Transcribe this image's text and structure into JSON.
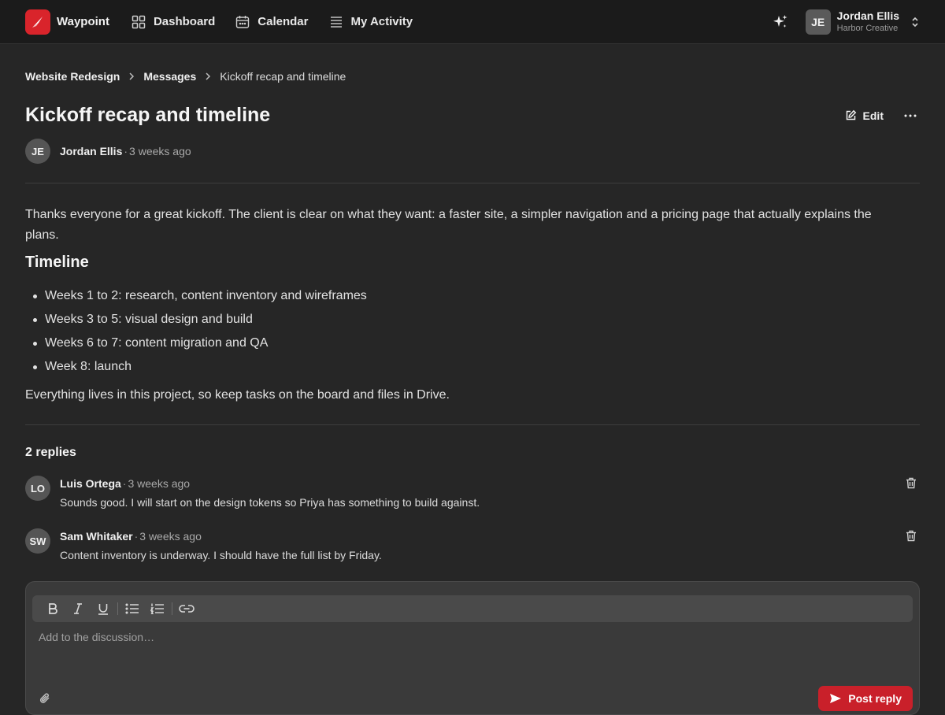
{
  "app": {
    "name": "Waypoint",
    "brand_color": "#d9242b"
  },
  "nav": {
    "items": [
      {
        "label": "Dashboard",
        "icon": "grid-icon"
      },
      {
        "label": "Calendar",
        "icon": "calendar-icon"
      },
      {
        "label": "My Activity",
        "icon": "list-icon"
      }
    ]
  },
  "user": {
    "initials": "JE",
    "name": "Jordan Ellis",
    "org": "Harbor Creative"
  },
  "breadcrumb": {
    "project": "Website Redesign",
    "section": "Messages",
    "current": "Kickoff recap and timeline"
  },
  "message": {
    "title": "Kickoff recap and timeline",
    "edit_label": "Edit",
    "author_initials": "JE",
    "author": "Jordan Ellis",
    "time": "3 weeks ago",
    "intro": "Thanks everyone for a great kickoff. The client is clear on what they want: a faster site, a simpler navigation and a pricing page that actually explains the plans.",
    "heading": "Timeline",
    "timeline": [
      "Weeks 1 to 2: research, content inventory and wireframes",
      "Weeks 3 to 5: visual design and build",
      "Weeks 6 to 7: content migration and QA",
      "Week 8: launch"
    ],
    "closing": "Everything lives in this project, so keep tasks on the board and files in Drive."
  },
  "replies": {
    "heading": "2 replies",
    "items": [
      {
        "initials": "LO",
        "author": "Luis Ortega",
        "time": "3 weeks ago",
        "text": "Sounds good. I will start on the design tokens so Priya has something to build against."
      },
      {
        "initials": "SW",
        "author": "Sam Whitaker",
        "time": "3 weeks ago",
        "text": "Content inventory is underway. I should have the full list by Friday."
      }
    ]
  },
  "composer": {
    "placeholder": "Add to the discussion…",
    "post_label": "Post reply",
    "accent": "#c9202a"
  },
  "meta_separator": "·"
}
